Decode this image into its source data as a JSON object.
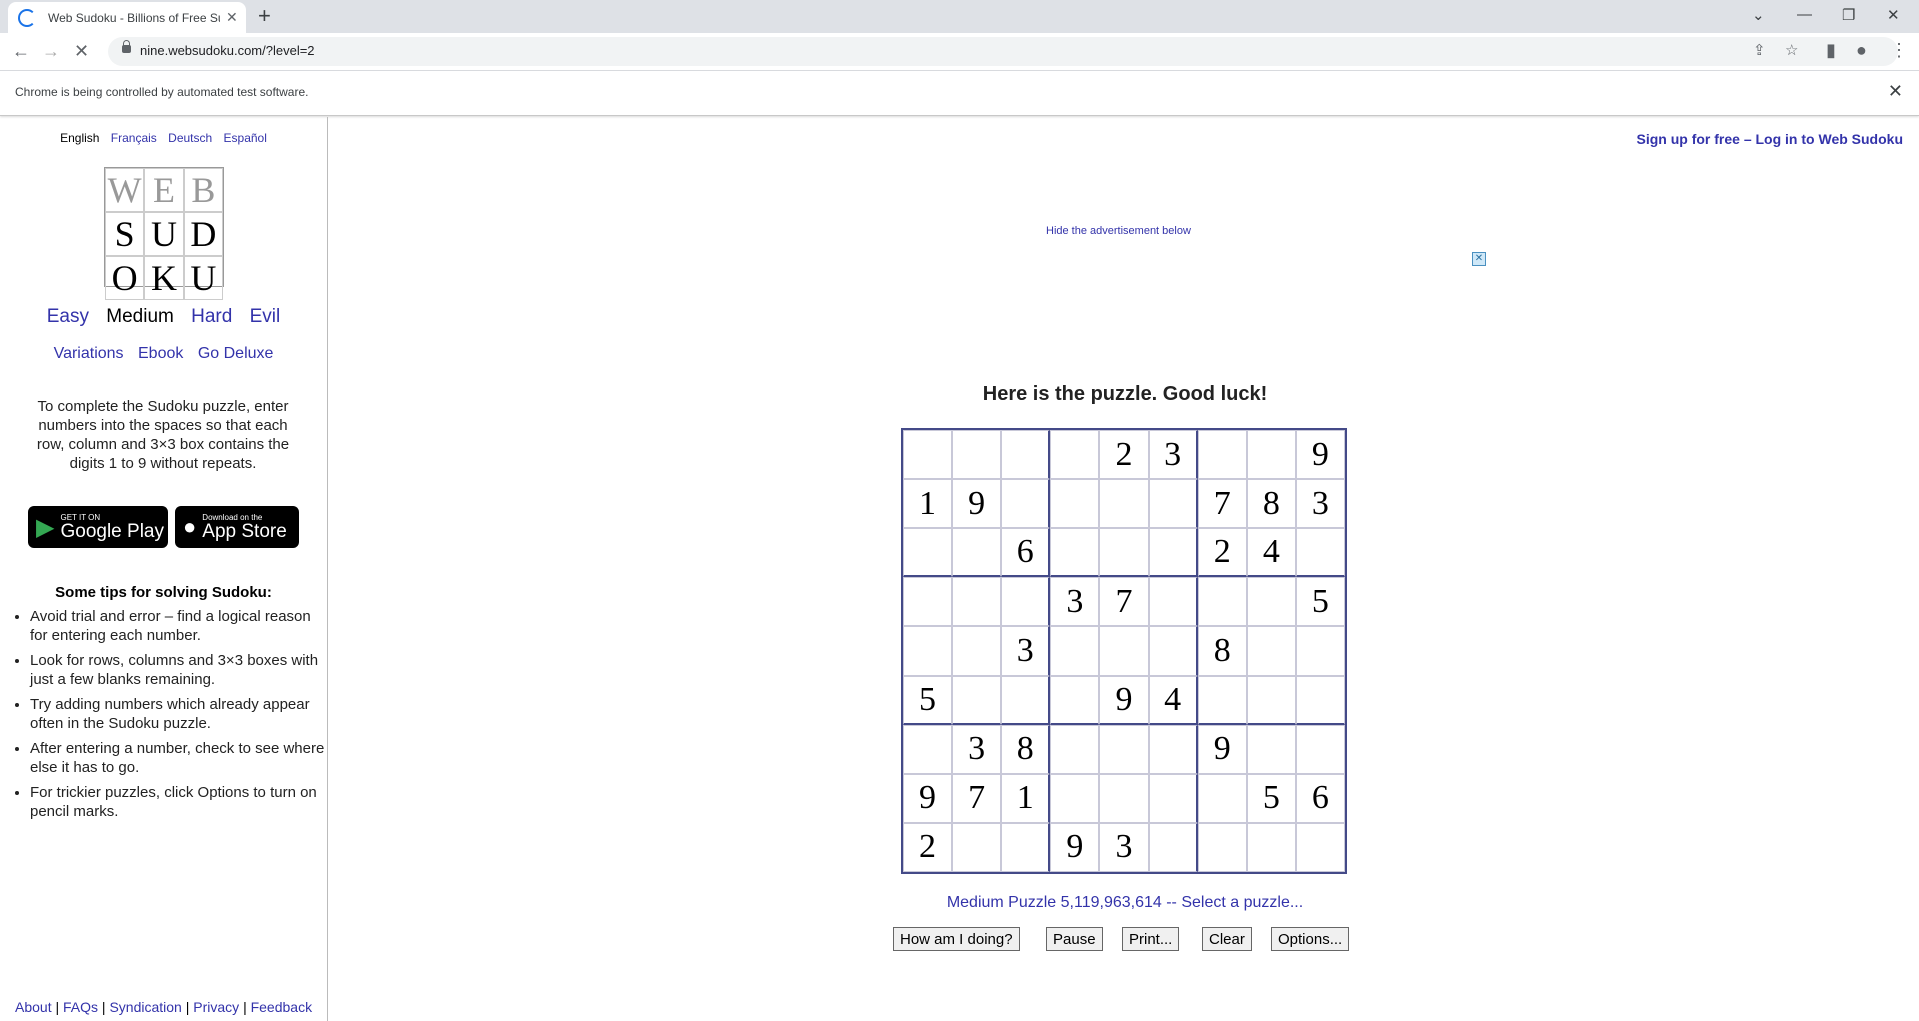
{
  "browser": {
    "tab_title": "Web Sudoku - Billions of Free Su",
    "url": "nine.websudoku.com/?level=2",
    "infobar_message": "Chrome is being controlled by automated test software."
  },
  "sidebar": {
    "languages": [
      "English",
      "Français",
      "Deutsch",
      "Español"
    ],
    "logo": [
      "W",
      "E",
      "B",
      "S",
      "U",
      "D",
      "O",
      "K",
      "U"
    ],
    "levels": [
      "Easy",
      "Medium",
      "Hard",
      "Evil"
    ],
    "links": [
      "Variations",
      "Ebook",
      "Go Deluxe"
    ],
    "intro": "To complete the Sudoku puzzle, enter numbers into the spaces so that each row, column and 3×3 box contains the digits 1 to 9 without repeats.",
    "google_play": {
      "small": "GET IT ON",
      "large": "Google Play"
    },
    "app_store": {
      "small": "Download on the",
      "large": "App Store"
    },
    "tips_title": "Some tips for solving Sudoku:",
    "tips": [
      "Avoid trial and error – find a logical reason for entering each number.",
      "Look for rows, columns and 3×3 boxes with just a few blanks remaining.",
      "Try adding numbers which already appear often in the Sudoku puzzle.",
      "After entering a number, check to see where else it has to go.",
      "For trickier puzzles, click Options to turn on pencil marks."
    ],
    "footer": [
      "About",
      "FAQs",
      "Syndication",
      "Privacy",
      "Feedback"
    ]
  },
  "header": {
    "signup": "Sign up for free – Log in to Web Sudoku",
    "hide_ad": "Hide the advertisement below"
  },
  "puzzle": {
    "title": "Here is the puzzle. Good luck!",
    "grid": [
      [
        "",
        "",
        "",
        "",
        "2",
        "3",
        "",
        "",
        "9"
      ],
      [
        "1",
        "9",
        "",
        "",
        "",
        "",
        "7",
        "8",
        "3"
      ],
      [
        "",
        "",
        "6",
        "",
        "",
        "",
        "2",
        "4",
        ""
      ],
      [
        "",
        "",
        "",
        "3",
        "7",
        "",
        "",
        "",
        "5"
      ],
      [
        "",
        "",
        "3",
        "",
        "",
        "",
        "8",
        "",
        ""
      ],
      [
        "5",
        "",
        "",
        "",
        "9",
        "4",
        "",
        "",
        ""
      ],
      [
        "",
        "3",
        "8",
        "",
        "",
        "",
        "9",
        "",
        ""
      ],
      [
        "9",
        "7",
        "1",
        "",
        "",
        "",
        "",
        "5",
        "6"
      ],
      [
        "2",
        "",
        "",
        "9",
        "3",
        "",
        "",
        "",
        ""
      ]
    ],
    "info": "Medium Puzzle 5,119,963,614 -- Select a puzzle...",
    "buttons": {
      "how": "How am I doing?",
      "pause": "Pause",
      "print": "Print...",
      "clear": "Clear",
      "options": "Options..."
    }
  }
}
